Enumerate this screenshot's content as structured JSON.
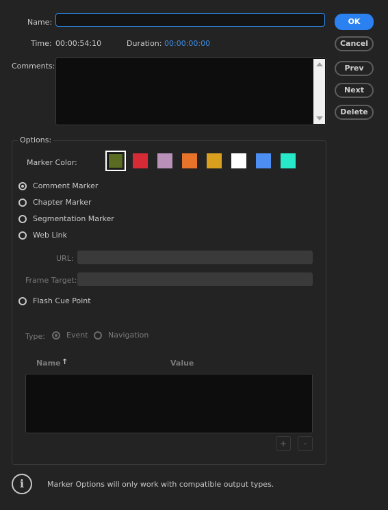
{
  "form": {
    "name_label": "Name:",
    "name_value": "",
    "time_label": "Time:",
    "time_value": "00:00:54:10",
    "duration_label": "Duration:",
    "duration_value": "00:00:00:00",
    "comments_label": "Comments:",
    "comments_value": ""
  },
  "buttons": {
    "ok": "OK",
    "cancel": "Cancel",
    "prev": "Prev",
    "next": "Next",
    "delete": "Delete"
  },
  "options": {
    "title": "Options:",
    "marker_color_label": "Marker Color:",
    "colors": [
      "#5a6b22",
      "#d62a37",
      "#b890b8",
      "#e8732a",
      "#d9a020",
      "#ffffff",
      "#4c8ef2",
      "#27e8c8"
    ],
    "selected_color_index": 0,
    "marker_types": [
      {
        "label": "Comment Marker",
        "selected": true
      },
      {
        "label": "Chapter Marker",
        "selected": false
      },
      {
        "label": "Segmentation Marker",
        "selected": false
      },
      {
        "label": "Web Link",
        "selected": false
      }
    ],
    "url_label": "URL:",
    "url_value": "",
    "frame_target_label": "Frame Target:",
    "frame_target_value": "",
    "flash_cue_label": "Flash Cue Point",
    "type_label": "Type:",
    "type_event": "Event",
    "type_navigation": "Navigation",
    "type_selected": "Event",
    "table": {
      "col_name": "Name",
      "col_value": "Value",
      "sort_indicator": "↑",
      "rows": []
    },
    "add_label": "+",
    "remove_label": "-"
  },
  "footer": {
    "info_icon": "i",
    "message": "Marker Options will only work with compatible output types."
  }
}
